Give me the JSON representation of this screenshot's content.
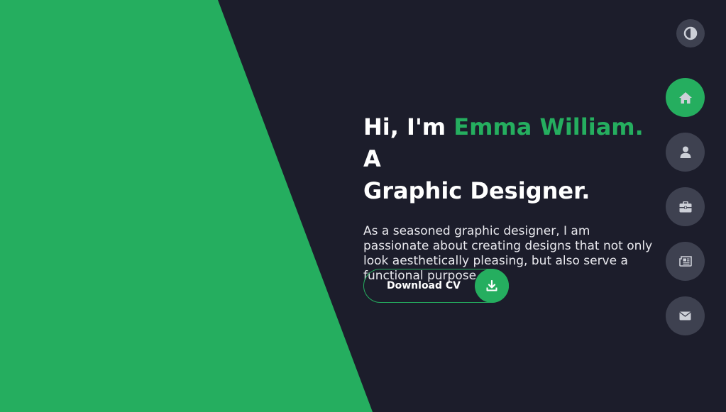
{
  "hero": {
    "greeting": "Hi, I'm ",
    "name": "Emma William.",
    "role_a": " A",
    "role_b": "Graphic Designer.",
    "description": "As a seasoned graphic designer, I am passionate about creating designs that not only look aesthetically pleasing, but also serve a functional purpose."
  },
  "cta": {
    "label": "Download CV",
    "icon": "download-icon"
  },
  "theme_toggle": {
    "icon": "contrast-icon"
  },
  "nav": {
    "items": [
      {
        "icon": "home-icon",
        "active": true
      },
      {
        "icon": "user-icon",
        "active": false
      },
      {
        "icon": "briefcase-icon",
        "active": false
      },
      {
        "icon": "newspaper-icon",
        "active": false
      },
      {
        "icon": "envelope-icon",
        "active": false
      }
    ]
  },
  "colors": {
    "accent": "#25ae5f",
    "background": "#1c1d2b",
    "nav_button": "#3e4150",
    "icon": "#cdd0d8"
  }
}
